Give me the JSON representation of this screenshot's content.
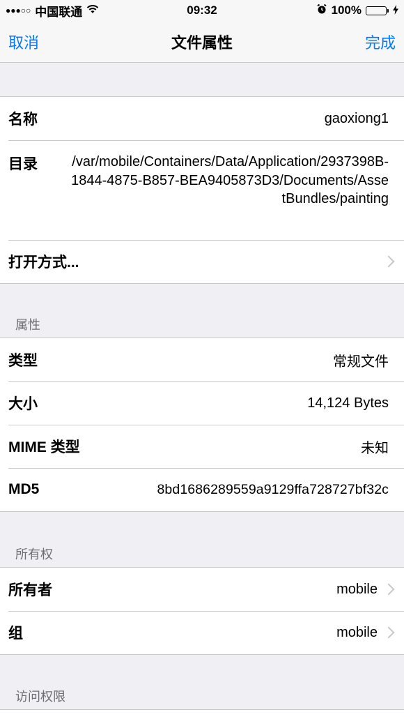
{
  "status_bar": {
    "signal": "●●●○○",
    "carrier": "中国联通",
    "wifi_icon": "wifi-icon",
    "time": "09:32",
    "alarm_icon": "alarm-icon",
    "battery_percent": "100%",
    "battery_level": 1.0
  },
  "nav": {
    "cancel": "取消",
    "title": "文件属性",
    "done": "完成",
    "accent_color": "#007aff"
  },
  "file": {
    "name_label": "名称",
    "name_value": "gaoxiong1",
    "dir_label": "目录",
    "dir_value": "/var/mobile/Containers/Data/Application/2937398B-1844-4875-B857-BEA9405873D3/Documents/AssetBundles/painting",
    "open_with_label": "打开方式..."
  },
  "attributes": {
    "header": "属性",
    "type_label": "类型",
    "type_value": "常规文件",
    "size_label": "大小",
    "size_value": "14,124 Bytes",
    "mime_label": "MIME 类型",
    "mime_value": "未知",
    "md5_label": "MD5",
    "md5_value": "8bd1686289559a9129ffa728727bf32c"
  },
  "ownership": {
    "header": "所有权",
    "owner_label": "所有者",
    "owner_value": "mobile",
    "group_label": "组",
    "group_value": "mobile"
  },
  "permissions": {
    "header": "访问权限"
  }
}
